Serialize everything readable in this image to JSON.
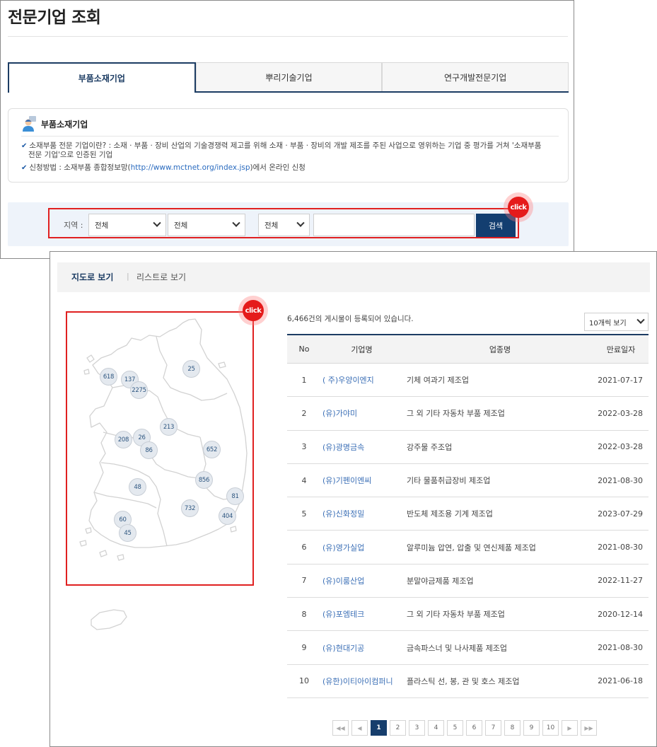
{
  "page": {
    "title": "전문기업 조회"
  },
  "tabs": [
    {
      "label": "부품소재기업",
      "active": true
    },
    {
      "label": "뿌리기술기업",
      "active": false
    },
    {
      "label": "연구개발전문기업",
      "active": false
    }
  ],
  "info": {
    "title": "부품소재기업",
    "line1a": "소재부품 전문 기업이란? : 소재 · 부품 · 장비 산업의 기술경쟁력 제고를 위해 소재 · 부품 · 장비의 개발 제조를 주된 사업으로 영위하는 기업 중 평가를 거쳐 '소재부품",
    "line1b": "전문 기업'으로 인증된 기업",
    "line2_prefix": "신청방법 : 소재부품 종합정보망(",
    "line2_link": "http://www.mctnet.org/index.jsp",
    "line2_suffix": ")에서 온라인 신청"
  },
  "search": {
    "region_label": "지역 :",
    "region1": "전체",
    "region2": "전체",
    "type": "전체",
    "keyword": "",
    "button": "검색"
  },
  "annotations": {
    "click_label": "click"
  },
  "view": {
    "map_label": "지도로 보기",
    "separator": "|",
    "list_label": "리스트로 보기"
  },
  "map": {
    "clusters": [
      "618",
      "137",
      "2275",
      "25",
      "213",
      "208",
      "26",
      "86",
      "652",
      "48",
      "856",
      "81",
      "732",
      "404",
      "60",
      "45"
    ]
  },
  "list": {
    "total_text": "6,466건의 게시물이 등록되어 있습니다.",
    "per_page": "10개씩 보기",
    "headers": {
      "no": "No",
      "name": "기업명",
      "industry": "업종명",
      "date": "만료일자"
    },
    "rows": [
      {
        "no": "1",
        "name": "( 주)우양이엔지",
        "industry": "기체 여과기 제조업",
        "date": "2021-07-17"
      },
      {
        "no": "2",
        "name": "(유)가야미",
        "industry": "그 외 기타 자동차 부품 제조업",
        "date": "2022-03-28"
      },
      {
        "no": "3",
        "name": "(유)광명금속",
        "industry": "강주물 주조업",
        "date": "2022-03-28"
      },
      {
        "no": "4",
        "name": "(유)기펜이엔씨",
        "industry": "기타 물품취급장비 제조업",
        "date": "2021-08-30"
      },
      {
        "no": "5",
        "name": "(유)신화정밀",
        "industry": "반도체 제조용 기계 제조업",
        "date": "2023-07-29"
      },
      {
        "no": "6",
        "name": "(유)영가실업",
        "industry": "알루미늄 압연, 압출 및 연신제품 제조업",
        "date": "2021-08-30"
      },
      {
        "no": "7",
        "name": "(유)이룸산업",
        "industry": "분말야금제품 제조업",
        "date": "2022-11-27"
      },
      {
        "no": "8",
        "name": "(유)포엠테크",
        "industry": "그 외 기타 자동차 부품 제조업",
        "date": "2020-12-14"
      },
      {
        "no": "9",
        "name": "(유)현대기공",
        "industry": "금속파스너 및 나사제품 제조업",
        "date": "2021-08-30"
      },
      {
        "no": "10",
        "name": "(유한)이티아이컴퍼니",
        "industry": "플라스틱 선, 봉, 관 및 호스 제조업",
        "date": "2021-06-18"
      }
    ]
  },
  "pagination": {
    "first": "◀◀",
    "prev": "◀",
    "pages": [
      "1",
      "2",
      "3",
      "4",
      "5",
      "6",
      "7",
      "8",
      "9",
      "10"
    ],
    "current": "1",
    "next": "▶",
    "last": "▶▶"
  },
  "colors": {
    "primary": "#1c3c63",
    "button": "#133e70",
    "highlight": "#e02020",
    "link": "#3b6fb6"
  }
}
